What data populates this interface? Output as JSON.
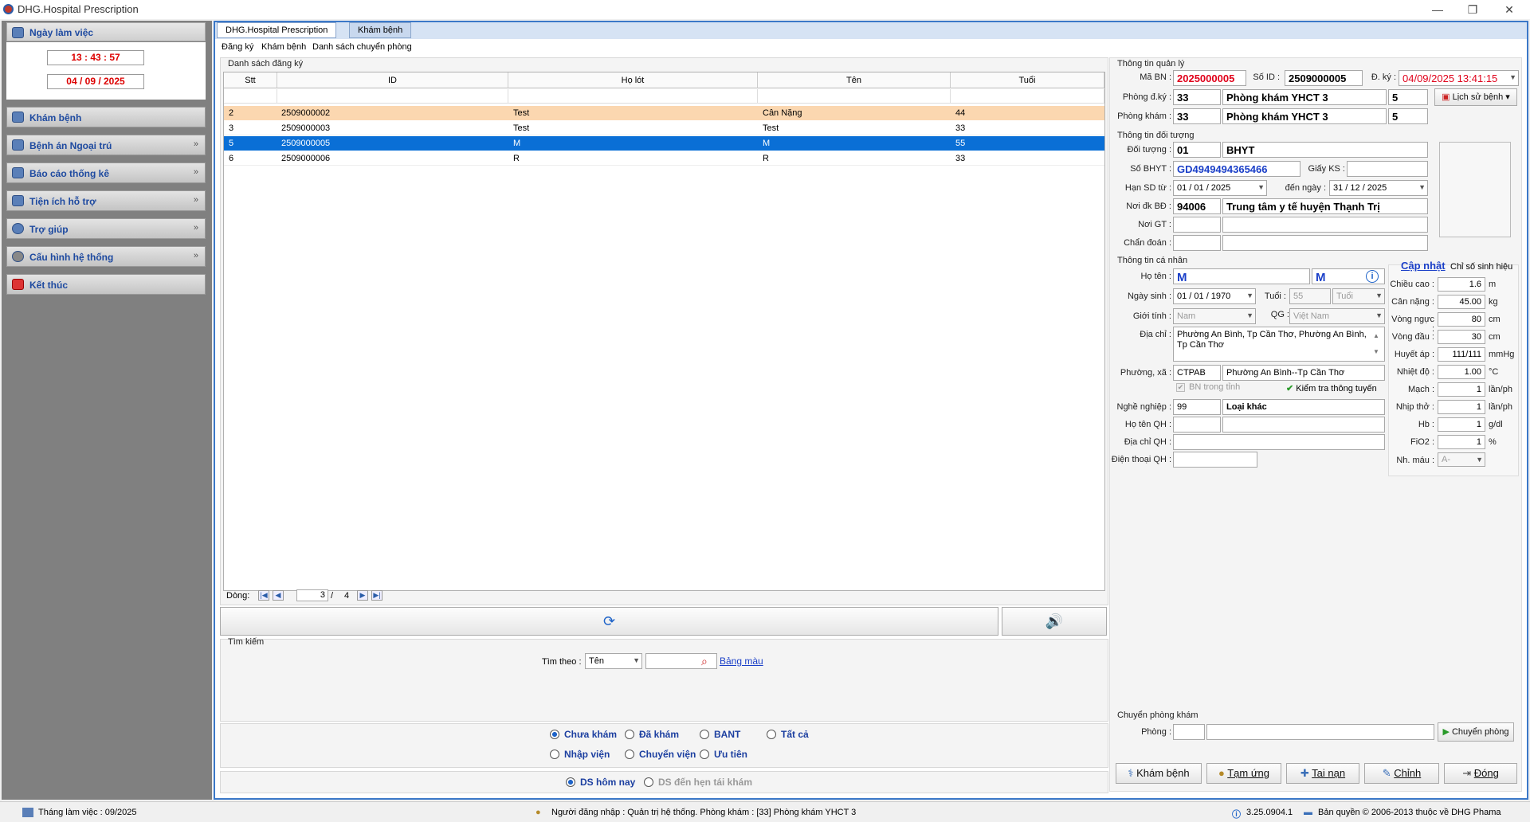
{
  "app": {
    "title": "DHG.Hospital Prescription"
  },
  "sidebar": {
    "header": "Ngày làm việc",
    "time": "13 : 43 : 57",
    "date": "04 / 09 / 2025",
    "items": [
      {
        "label": "Khám bệnh",
        "chevron": ""
      },
      {
        "label": "Bệnh án Ngoại trú",
        "chevron": "»"
      },
      {
        "label": "Báo cáo thống kê",
        "chevron": "»"
      },
      {
        "label": "Tiện ích hỗ trợ",
        "chevron": "»"
      },
      {
        "label": "Trợ giúp",
        "chevron": "»"
      },
      {
        "label": "Cấu hình hệ thống",
        "chevron": "»"
      },
      {
        "label": "Kết thúc",
        "chevron": ""
      }
    ]
  },
  "tabs": [
    "DHG.Hospital Prescription",
    "Khám bệnh"
  ],
  "subtabs": [
    "Đăng ký",
    "Khám bệnh",
    "Danh sách chuyển phòng"
  ],
  "list": {
    "title": "Danh sách đăng ký",
    "columns": [
      "Stt",
      "ID",
      "Họ lót",
      "Tên",
      "Tuổi"
    ],
    "rows": [
      {
        "stt": "2",
        "id": "2509000002",
        "holot": "Test",
        "ten": "Cân Nặng",
        "tuoi": "44"
      },
      {
        "stt": "3",
        "id": "2509000003",
        "holot": "Test",
        "ten": "Test",
        "tuoi": "33"
      },
      {
        "stt": "5",
        "id": "2509000005",
        "holot": "M",
        "ten": "M",
        "tuoi": "55"
      },
      {
        "stt": "6",
        "id": "2509000006",
        "holot": "R",
        "ten": "R",
        "tuoi": "33"
      }
    ],
    "selected_index": 2,
    "highlight_index": 0,
    "nav": {
      "label": "Dòng:",
      "current": "3",
      "sep": "/",
      "total": "4"
    }
  },
  "search": {
    "title": "Tìm kiếm",
    "by_label": "Tìm theo :",
    "by_value": "Tên",
    "input": "",
    "link": "Bảng màu"
  },
  "filters": {
    "row1": [
      {
        "label": "Chưa khám",
        "on": true
      },
      {
        "label": "Đã khám",
        "on": false
      },
      {
        "label": "BANT",
        "on": false
      },
      {
        "label": "Tất cả",
        "on": false
      }
    ],
    "row2": [
      {
        "label": "Nhập viện",
        "on": false
      },
      {
        "label": "Chuyển viện",
        "on": false
      },
      {
        "label": "Ưu tiên",
        "on": false
      }
    ],
    "row3": [
      {
        "label": "DS hôm nay",
        "on": true
      },
      {
        "label": "DS đến hẹn tái khám",
        "on": false
      }
    ]
  },
  "quanly": {
    "title": "Thông tin quản lý",
    "ma_bn_label": "Mã BN :",
    "ma_bn": "2025000005",
    "so_id_label": "Số ID :",
    "so_id": "2509000005",
    "dky_label": "Đ. ký :",
    "dky": "04/09/2025 13:41:15",
    "phong_dk_label": "Phòng đ.ký :",
    "phong_dk_code": "33",
    "phong_dk_name": "Phòng khám YHCT 3",
    "phong_dk_num": "5",
    "lich_su": "Lịch sử bệnh",
    "phong_kham_label": "Phòng khám :",
    "phong_kham_code": "33",
    "phong_kham_name": "Phòng khám YHCT 3",
    "phong_kham_num": "5"
  },
  "doituong": {
    "title": "Thông tin đối tượng",
    "doi_tuong_label": "Đối tượng :",
    "doi_tuong_code": "01",
    "doi_tuong_name": "BHYT",
    "so_bhyt_label": "Số BHYT :",
    "so_bhyt": "GD4949494365466",
    "giay_ks_label": "Giấy KS :",
    "giay_ks": "",
    "han_label": "Hạn SD từ :",
    "han_tu": "01 / 01 / 2025",
    "den_label": "đến ngày :",
    "han_den": "31 / 12 / 2025",
    "noi_dk_label": "Nơi đk BĐ :",
    "noi_dk_code": "94006",
    "noi_dk_name": "Trung tâm y tế huyện Thạnh Trị",
    "noi_gt_label": "Nơi GT :",
    "chan_doan_label": "Chẩn đoán :"
  },
  "canhan": {
    "title": "Thông tin cá nhân",
    "ho_ten_label": "Họ tên :",
    "ho_ten": "M",
    "ten": "M",
    "ngay_sinh_label": "Ngày sinh :",
    "ngay_sinh": "01 / 01 / 1970",
    "tuoi_label": "Tuổi :",
    "tuoi": "55",
    "tuoi_unit": "Tuổi",
    "gioi_tinh_label": "Giới tính :",
    "gioi_tinh": "Nam",
    "qg_label": "QG :",
    "qg": "Việt Nam",
    "dia_chi_label": "Địa chỉ :",
    "dia_chi": "Phường An Bình, Tp Cần Thơ, Phường An Bình, Tp Cần Thơ",
    "phuong_label": "Phường, xã :",
    "phuong_code": "CTPAB",
    "phuong_name": "Phường An Bình--Tp Cần Thơ",
    "bn_trong_tinh": "BN trong tỉnh",
    "kiem_tra": "Kiểm tra thông tuyến",
    "nghe_label": "Nghề nghiệp :",
    "nghe_code": "99",
    "nghe_name": "Loại khác",
    "ho_ten_qh_label": "Họ tên QH :",
    "dia_chi_qh_label": "Địa chỉ QH :",
    "dien_thoai_qh_label": "Điện thoại QH :"
  },
  "vitals": {
    "update_link": "Cập nhật",
    "title": "Chỉ số sinh hiệu",
    "items": [
      {
        "label": "Chiều cao :",
        "value": "1.6",
        "unit": "m"
      },
      {
        "label": "Cân nặng :",
        "value": "45.00",
        "unit": "kg"
      },
      {
        "label": "Vòng ngực :",
        "value": "80",
        "unit": "cm"
      },
      {
        "label": "Vòng đầu :",
        "value": "30",
        "unit": "cm"
      },
      {
        "label": "Huyết áp :",
        "value": "111/111",
        "unit": "mmHg"
      },
      {
        "label": "Nhiệt độ :",
        "value": "1.00",
        "unit": "°C"
      },
      {
        "label": "Mạch :",
        "value": "1",
        "unit": "lần/ph"
      },
      {
        "label": "Nhịp thở :",
        "value": "1",
        "unit": "lần/ph"
      },
      {
        "label": "Hb :",
        "value": "1",
        "unit": "g/dl"
      },
      {
        "label": "FiO2 :",
        "value": "1",
        "unit": "%"
      }
    ],
    "nhom_mau_label": "Nh. máu :",
    "nhom_mau": "A-"
  },
  "chuyen": {
    "title": "Chuyển phòng khám",
    "phong_label": "Phòng :",
    "button": "Chuyển phòng"
  },
  "actions": [
    "Khám bệnh",
    "Tạm ứng",
    "Tai nạn",
    "Chỉnh",
    "Đóng"
  ],
  "status": {
    "thang": "Tháng làm việc : 09/2025",
    "nguoi": "Người đăng nhập : Quản trị hệ thống. Phòng khám : [33] Phòng khám YHCT 3",
    "version": "3.25.0904.1",
    "copyright": "Bản quyền © 2006-2013 thuộc về DHG Phama"
  }
}
